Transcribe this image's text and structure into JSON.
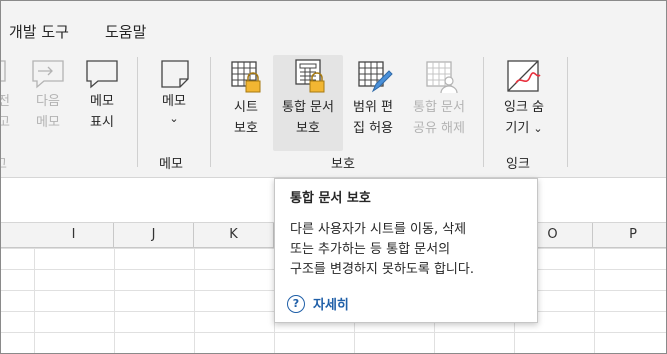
{
  "menubar": {
    "items": [
      "개발 도구",
      "도움말"
    ]
  },
  "ribbon": {
    "comments": {
      "partial_prev": [
        "전",
        "고"
      ],
      "next": [
        "다음",
        "메모"
      ],
      "show": [
        "메모",
        "표시"
      ],
      "partial_group_edge": "고"
    },
    "memo": {
      "button": "메모",
      "chevron": "⌄",
      "group_label": "메모"
    },
    "protect": {
      "sheet": [
        "시트",
        "보호"
      ],
      "workbook": [
        "통합 문서",
        "보호"
      ],
      "allow_ranges": [
        "범위 편",
        "집 허용"
      ],
      "unshare": [
        "통합 문서",
        "공유 해제"
      ],
      "group_label": "보호"
    },
    "ink": {
      "hide": [
        "잉크 숨",
        "기기"
      ],
      "chevron": "⌄",
      "group_label": "잉크"
    }
  },
  "columns": [
    "I",
    "J",
    "K",
    "",
    "",
    "O",
    "P"
  ],
  "tooltip": {
    "title": "통합 문서 보호",
    "body": "다른 사용자가 시트를 이동, 삭제\n또는 추가하는 등 통합 문서의\n구조를 변경하지 못하도록 합니다.",
    "help_icon_glyph": "?",
    "help_label": "자세히"
  },
  "colors": {
    "accent": "#1f5fa8",
    "lock": "#f2b632",
    "pen": "#e8303d",
    "edit_pen": "#4a90d9"
  }
}
